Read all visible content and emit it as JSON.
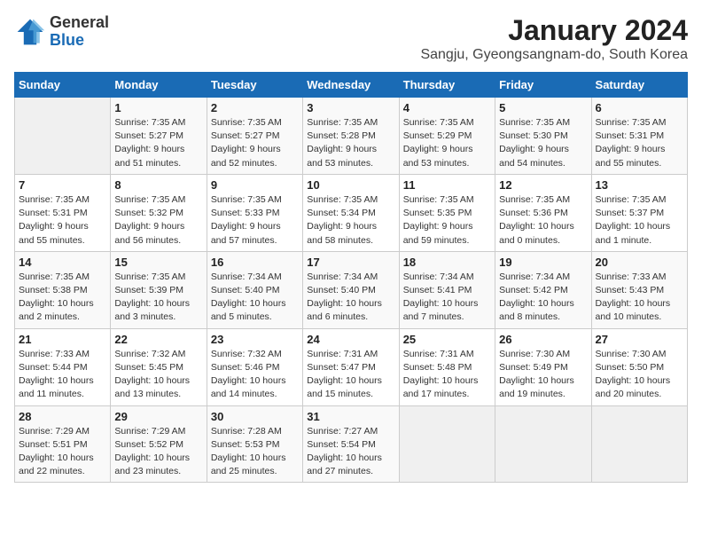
{
  "header": {
    "logo_general": "General",
    "logo_blue": "Blue",
    "title": "January 2024",
    "subtitle": "Sangju, Gyeongsangnam-do, South Korea"
  },
  "days_of_week": [
    "Sunday",
    "Monday",
    "Tuesday",
    "Wednesday",
    "Thursday",
    "Friday",
    "Saturday"
  ],
  "weeks": [
    [
      {
        "day": "",
        "info": ""
      },
      {
        "day": "1",
        "info": "Sunrise: 7:35 AM\nSunset: 5:27 PM\nDaylight: 9 hours\nand 51 minutes."
      },
      {
        "day": "2",
        "info": "Sunrise: 7:35 AM\nSunset: 5:27 PM\nDaylight: 9 hours\nand 52 minutes."
      },
      {
        "day": "3",
        "info": "Sunrise: 7:35 AM\nSunset: 5:28 PM\nDaylight: 9 hours\nand 53 minutes."
      },
      {
        "day": "4",
        "info": "Sunrise: 7:35 AM\nSunset: 5:29 PM\nDaylight: 9 hours\nand 53 minutes."
      },
      {
        "day": "5",
        "info": "Sunrise: 7:35 AM\nSunset: 5:30 PM\nDaylight: 9 hours\nand 54 minutes."
      },
      {
        "day": "6",
        "info": "Sunrise: 7:35 AM\nSunset: 5:31 PM\nDaylight: 9 hours\nand 55 minutes."
      }
    ],
    [
      {
        "day": "7",
        "info": "Sunrise: 7:35 AM\nSunset: 5:31 PM\nDaylight: 9 hours\nand 55 minutes."
      },
      {
        "day": "8",
        "info": "Sunrise: 7:35 AM\nSunset: 5:32 PM\nDaylight: 9 hours\nand 56 minutes."
      },
      {
        "day": "9",
        "info": "Sunrise: 7:35 AM\nSunset: 5:33 PM\nDaylight: 9 hours\nand 57 minutes."
      },
      {
        "day": "10",
        "info": "Sunrise: 7:35 AM\nSunset: 5:34 PM\nDaylight: 9 hours\nand 58 minutes."
      },
      {
        "day": "11",
        "info": "Sunrise: 7:35 AM\nSunset: 5:35 PM\nDaylight: 9 hours\nand 59 minutes."
      },
      {
        "day": "12",
        "info": "Sunrise: 7:35 AM\nSunset: 5:36 PM\nDaylight: 10 hours\nand 0 minutes."
      },
      {
        "day": "13",
        "info": "Sunrise: 7:35 AM\nSunset: 5:37 PM\nDaylight: 10 hours\nand 1 minute."
      }
    ],
    [
      {
        "day": "14",
        "info": "Sunrise: 7:35 AM\nSunset: 5:38 PM\nDaylight: 10 hours\nand 2 minutes."
      },
      {
        "day": "15",
        "info": "Sunrise: 7:35 AM\nSunset: 5:39 PM\nDaylight: 10 hours\nand 3 minutes."
      },
      {
        "day": "16",
        "info": "Sunrise: 7:34 AM\nSunset: 5:40 PM\nDaylight: 10 hours\nand 5 minutes."
      },
      {
        "day": "17",
        "info": "Sunrise: 7:34 AM\nSunset: 5:40 PM\nDaylight: 10 hours\nand 6 minutes."
      },
      {
        "day": "18",
        "info": "Sunrise: 7:34 AM\nSunset: 5:41 PM\nDaylight: 10 hours\nand 7 minutes."
      },
      {
        "day": "19",
        "info": "Sunrise: 7:34 AM\nSunset: 5:42 PM\nDaylight: 10 hours\nand 8 minutes."
      },
      {
        "day": "20",
        "info": "Sunrise: 7:33 AM\nSunset: 5:43 PM\nDaylight: 10 hours\nand 10 minutes."
      }
    ],
    [
      {
        "day": "21",
        "info": "Sunrise: 7:33 AM\nSunset: 5:44 PM\nDaylight: 10 hours\nand 11 minutes."
      },
      {
        "day": "22",
        "info": "Sunrise: 7:32 AM\nSunset: 5:45 PM\nDaylight: 10 hours\nand 13 minutes."
      },
      {
        "day": "23",
        "info": "Sunrise: 7:32 AM\nSunset: 5:46 PM\nDaylight: 10 hours\nand 14 minutes."
      },
      {
        "day": "24",
        "info": "Sunrise: 7:31 AM\nSunset: 5:47 PM\nDaylight: 10 hours\nand 15 minutes."
      },
      {
        "day": "25",
        "info": "Sunrise: 7:31 AM\nSunset: 5:48 PM\nDaylight: 10 hours\nand 17 minutes."
      },
      {
        "day": "26",
        "info": "Sunrise: 7:30 AM\nSunset: 5:49 PM\nDaylight: 10 hours\nand 19 minutes."
      },
      {
        "day": "27",
        "info": "Sunrise: 7:30 AM\nSunset: 5:50 PM\nDaylight: 10 hours\nand 20 minutes."
      }
    ],
    [
      {
        "day": "28",
        "info": "Sunrise: 7:29 AM\nSunset: 5:51 PM\nDaylight: 10 hours\nand 22 minutes."
      },
      {
        "day": "29",
        "info": "Sunrise: 7:29 AM\nSunset: 5:52 PM\nDaylight: 10 hours\nand 23 minutes."
      },
      {
        "day": "30",
        "info": "Sunrise: 7:28 AM\nSunset: 5:53 PM\nDaylight: 10 hours\nand 25 minutes."
      },
      {
        "day": "31",
        "info": "Sunrise: 7:27 AM\nSunset: 5:54 PM\nDaylight: 10 hours\nand 27 minutes."
      },
      {
        "day": "",
        "info": ""
      },
      {
        "day": "",
        "info": ""
      },
      {
        "day": "",
        "info": ""
      }
    ]
  ]
}
